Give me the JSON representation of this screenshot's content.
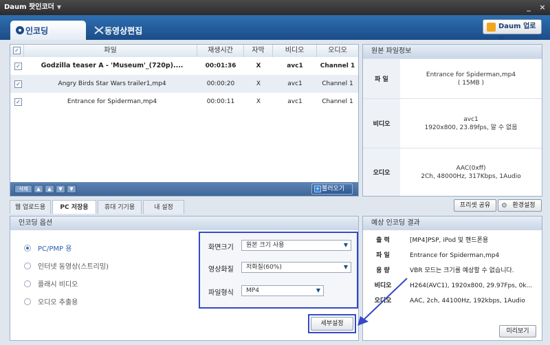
{
  "app": {
    "title": "Daum 팟인코더"
  },
  "window_controls": {
    "minimize": "_",
    "close": "×"
  },
  "main_tabs": [
    {
      "label": "인코딩",
      "active": true
    },
    {
      "label": "동영상편집",
      "active": false
    }
  ],
  "upload_button": "Daum 업로드",
  "file_table": {
    "columns": [
      "파일",
      "재생시간",
      "자막",
      "비디오",
      "오디오"
    ],
    "rows": [
      {
        "name": "Godzilla teaser A - 'Museum'_(720p)....",
        "duration": "00:01:36",
        "subtitle": "X",
        "video": "avc1",
        "audio": "Channel 1",
        "checked": true,
        "bold": true
      },
      {
        "name": "Angry Birds Star Wars trailer1,mp4",
        "duration": "00:00:20",
        "subtitle": "X",
        "video": "avc1",
        "audio": "Channel 1",
        "checked": true,
        "bold": false
      },
      {
        "name": "Entrance for Spiderman,mp4",
        "duration": "00:00:11",
        "subtitle": "X",
        "video": "avc1",
        "audio": "Channel 1",
        "checked": true,
        "bold": false
      }
    ],
    "toolbar": {
      "delete": "삭제",
      "load": "불러오기"
    }
  },
  "source_info": {
    "title": "원본 파일정보",
    "file_label": "파 일",
    "file_name": "Entrance for Spiderman,mp4",
    "file_size": "( 15MB )",
    "video_label": "비디오",
    "video_codec": "avc1",
    "video_detail": "1920x800, 23.89fps, 알 수 없음",
    "audio_label": "오디오",
    "audio_codec": "AAC(0xff)",
    "audio_detail": "2Ch, 48000Hz, 317Kbps, 1Audio"
  },
  "sub_tabs": [
    {
      "label": "웹 업로드용",
      "active": false
    },
    {
      "label": "PC 저장용",
      "active": true
    },
    {
      "label": "휴대 기기용",
      "active": false
    },
    {
      "label": "내 설정",
      "active": false
    }
  ],
  "preset_share": "프리셋 공유",
  "env_settings": "환경설정",
  "encoding_options": {
    "title": "인코딩 옵션",
    "radios": [
      {
        "label": "PC/PMP 용",
        "selected": true
      },
      {
        "label": "인터넷 동영상(스트리밍)",
        "selected": false
      },
      {
        "label": "플래시 비디오",
        "selected": false
      },
      {
        "label": "오디오 추출용",
        "selected": false
      }
    ],
    "screen_size_label": "화면크기",
    "screen_size_value": "원본 크기 사용",
    "quality_label": "영상화질",
    "quality_value": "저화질(60%)",
    "format_label": "파일형식",
    "format_value": "MP4",
    "detail_button": "세부설정"
  },
  "expected_result": {
    "title": "예상 인코딩 결과",
    "rows": [
      {
        "label": "출 력",
        "value": "[MP4]PSP, iPod 및 핸드폰용"
      },
      {
        "label": "파 일",
        "value": "Entrance for Spiderman,mp4"
      },
      {
        "label": "용 량",
        "value": "VBR 모드는 크기를 예상할 수 없습니다."
      },
      {
        "label": "비디오",
        "value": "H264(AVC1), 1920x800, 29.97Fps, 0k..."
      },
      {
        "label": "오디오",
        "value": "AAC, 2ch, 44100Hz, 192kbps, 1Audio"
      }
    ],
    "preview_button": "미리보기"
  },
  "colors": {
    "accent": "#1b4d88",
    "highlight_box": "#3548c8",
    "panel_border": "#9fb1c7"
  }
}
